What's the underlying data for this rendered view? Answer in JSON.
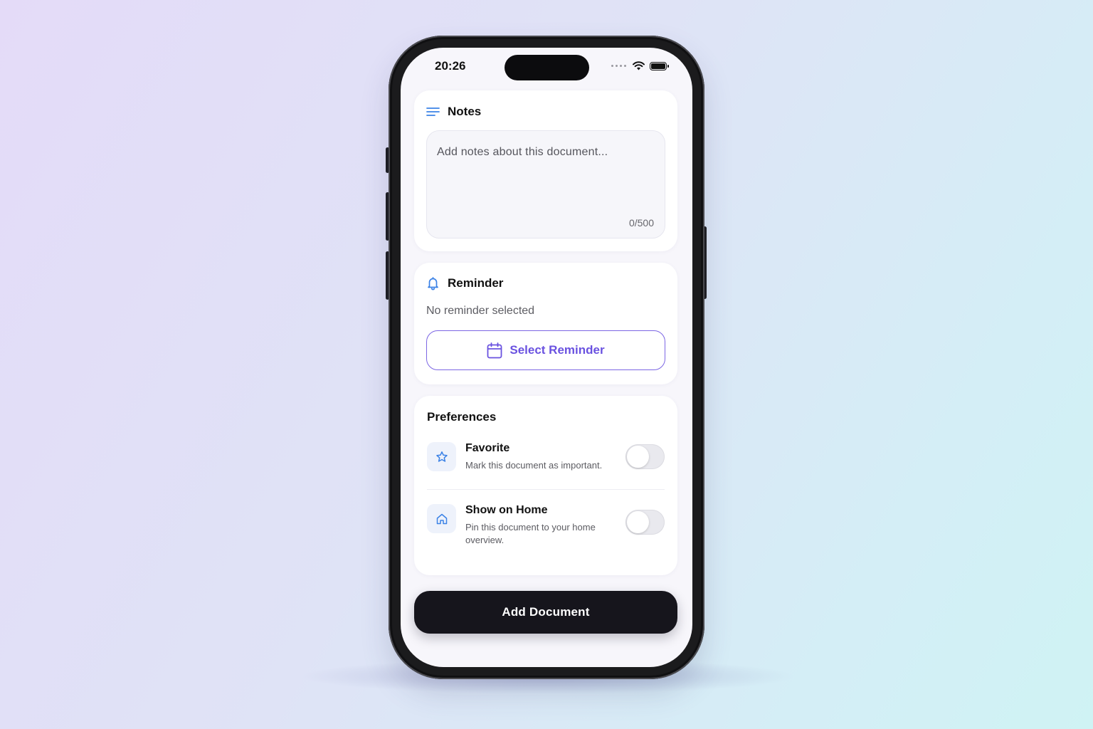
{
  "status_bar": {
    "time": "20:26"
  },
  "notes": {
    "title": "Notes",
    "placeholder": "Add notes about this document...",
    "counter": "0/500",
    "icon": "lines-icon"
  },
  "reminder": {
    "title": "Reminder",
    "status": "No reminder selected",
    "button_label": "Select Reminder",
    "icon": "bell-icon",
    "button_icon": "calendar-icon"
  },
  "preferences": {
    "title": "Preferences",
    "items": [
      {
        "label": "Favorite",
        "description": "Mark this document as important.",
        "icon": "star-icon",
        "enabled": false
      },
      {
        "label": "Show on Home",
        "description": "Pin this document to your home overview.",
        "icon": "home-icon",
        "enabled": false
      }
    ]
  },
  "primary_action": {
    "label": "Add Document"
  },
  "colors": {
    "accent": "#6a52e0",
    "icon_blue": "#3b82e6",
    "primary_button": "#16151c"
  }
}
